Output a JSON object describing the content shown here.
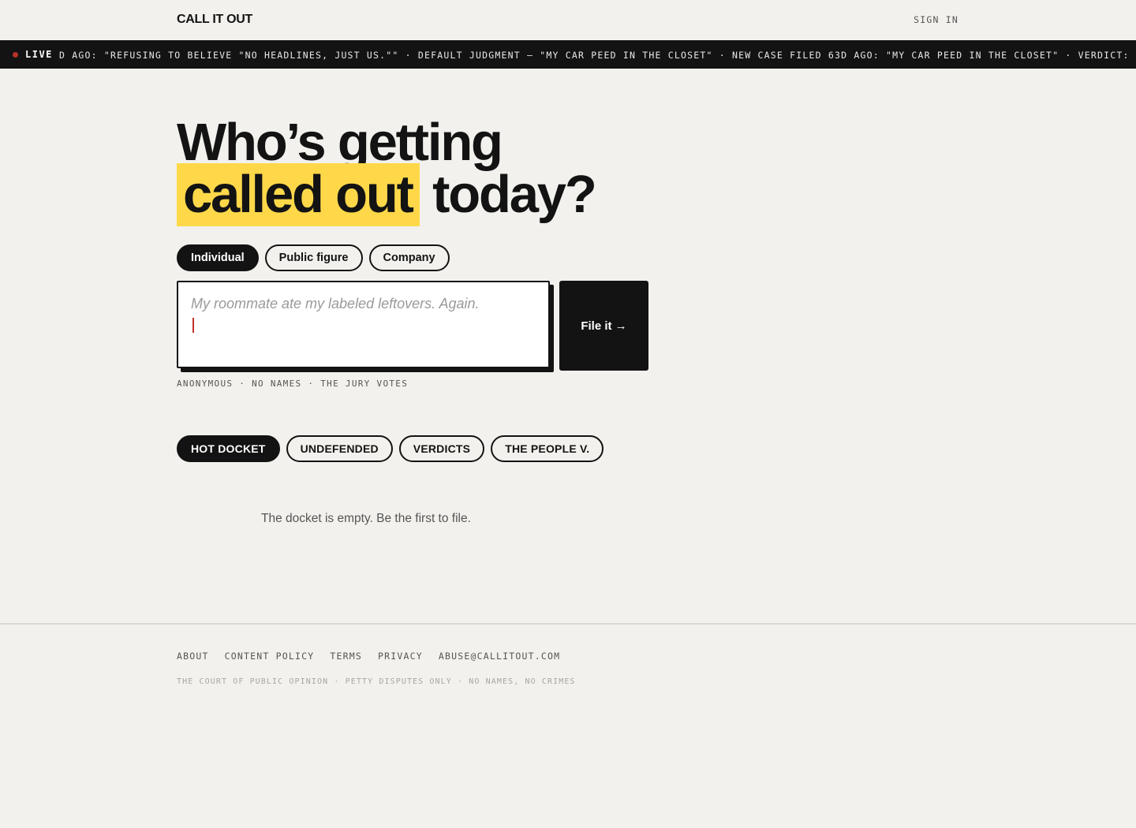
{
  "header": {
    "logo": "CALL IT OUT",
    "sign_in": "SIGN IN"
  },
  "ticker": {
    "live_label": "LIVE",
    "text": "D AGO: \"REFUSING TO BELIEVE \"NO HEADLINES, JUST US.\"\" · DEFAULT JUDGMENT — \"MY CAR PEED IN THE CLOSET\" · NEW CASE FILED 63D AGO: \"MY CAR PEED IN THE CLOSET\" · VERDICT: THE DEFENDANT"
  },
  "hero": {
    "line1": "Who’s getting",
    "highlight": "called out",
    "line2_rest": "today?"
  },
  "target_types": [
    {
      "label": "Individual",
      "active": true
    },
    {
      "label": "Public figure",
      "active": false
    },
    {
      "label": "Company",
      "active": false
    }
  ],
  "complaint": {
    "placeholder": "My roommate ate my labeled leftovers. Again.",
    "value": "",
    "submit_label": "File it →",
    "hint": "ANONYMOUS · NO NAMES · THE JURY VOTES"
  },
  "docket_tabs": [
    {
      "label": "HOT DOCKET",
      "active": true
    },
    {
      "label": "UNDEFENDED",
      "active": false
    },
    {
      "label": "VERDICTS",
      "active": false
    },
    {
      "label": "THE PEOPLE V.",
      "active": false
    }
  ],
  "docket": {
    "empty_message": "The docket is empty. Be the first to file."
  },
  "footer": {
    "links": [
      "ABOUT",
      "CONTENT POLICY",
      "TERMS",
      "PRIVACY",
      "ABUSE@CALLITOUT.COM"
    ],
    "note": "THE COURT OF PUBLIC OPINION · PETTY DISPUTES ONLY · NO NAMES, NO CRIMES"
  },
  "colors": {
    "background": "#f2f1ed",
    "ink": "#131313",
    "highlight": "#ffd84a",
    "live_dot": "#b8322a"
  }
}
